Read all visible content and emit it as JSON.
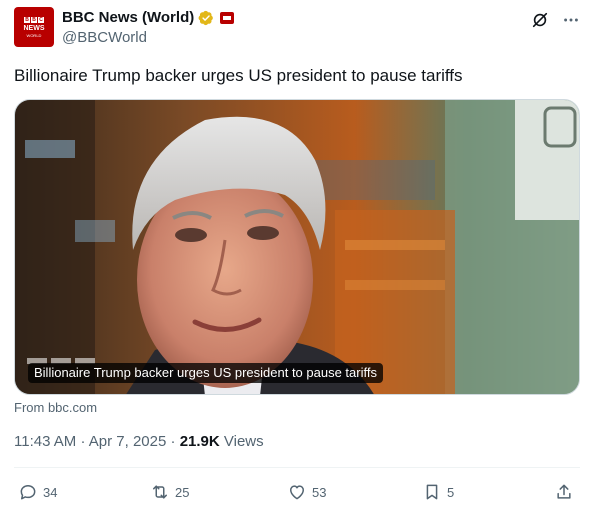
{
  "account": {
    "avatar_letters": [
      "B",
      "B",
      "C"
    ],
    "avatar_news": "NEWS",
    "avatar_world": "WORLD",
    "display_name": "BBC News (World)",
    "handle": "@BBCWorld"
  },
  "tweet": {
    "text": "Billionaire Trump backer urges US president to pause tariffs"
  },
  "card": {
    "caption": "Billionaire Trump backer urges US president to pause tariffs",
    "source": "From bbc.com"
  },
  "meta": {
    "time": "11:43 AM",
    "separator": "·",
    "date": "Apr 7, 2025",
    "views_count": "21.9K",
    "views_label": "Views"
  },
  "actions": {
    "replies": "34",
    "reposts": "25",
    "likes": "53",
    "bookmarks": "5"
  },
  "colors": {
    "verified_gold": "#e2b719",
    "bbc_red": "#b80000",
    "text_primary": "#0f1419",
    "text_secondary": "#536471"
  },
  "icons": [
    "grok-icon",
    "more-icon",
    "verified-badge-icon",
    "reply-icon",
    "repost-icon",
    "like-icon",
    "bookmark-icon",
    "share-icon"
  ]
}
